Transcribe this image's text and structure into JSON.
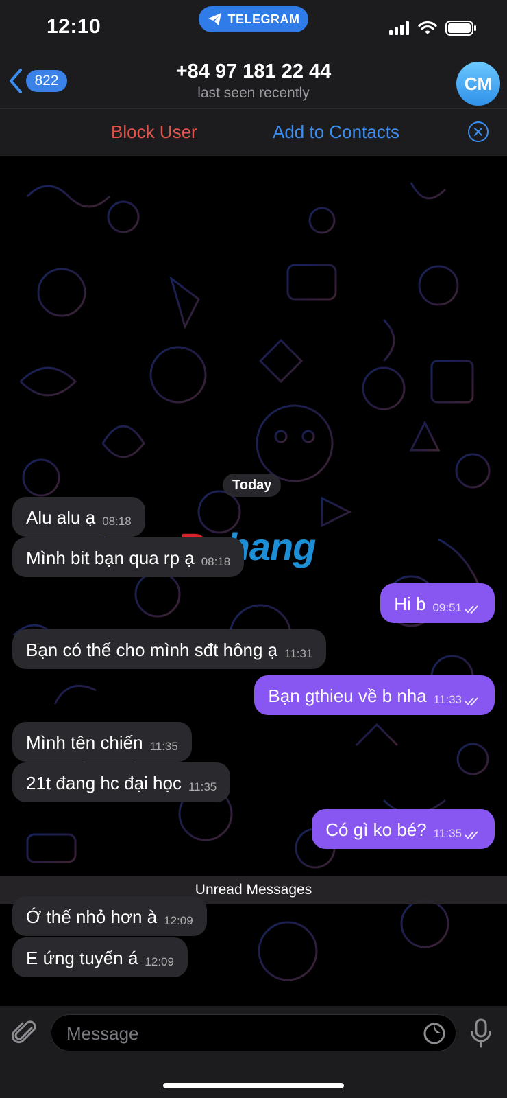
{
  "status": {
    "time": "12:10",
    "app_pill": "TELEGRAM"
  },
  "header": {
    "back_badge": "822",
    "title": "+84 97 181 22 44",
    "subtitle": "last seen recently",
    "avatar_initials": "CM"
  },
  "actions": {
    "block": "Block User",
    "add_contact": "Add to Contacts"
  },
  "chat": {
    "date_label": "Today",
    "unread_label": "Unread Messages",
    "watermark": {
      "first": "R",
      "rest": "phang"
    },
    "messages": [
      {
        "text": "Alu alu ạ",
        "time": "08:18"
      },
      {
        "text": "Mình bit bạn qua rp ạ",
        "time": "08:18"
      },
      {
        "text": "Hi b",
        "time": "09:51"
      },
      {
        "text": "Bạn có thể cho mình sđt hông ạ",
        "time": "11:31"
      },
      {
        "text": "Bạn gthieu về b nha",
        "time": "11:33"
      },
      {
        "text": "Mình tên chiến",
        "time": "11:35"
      },
      {
        "text": "21t đang hc đại học",
        "time": "11:35"
      },
      {
        "text": "Có gì ko bé?",
        "time": "11:35"
      },
      {
        "text": "Ớ thế nhỏ hơn à",
        "time": "12:09"
      },
      {
        "text": "E ứng tuyển á",
        "time": "12:09"
      }
    ]
  },
  "input": {
    "placeholder": "Message"
  },
  "colors": {
    "incoming": "#2a2a2e",
    "outgoing": "#8856f0",
    "link": "#3b8ef0",
    "danger": "#e5534b"
  }
}
